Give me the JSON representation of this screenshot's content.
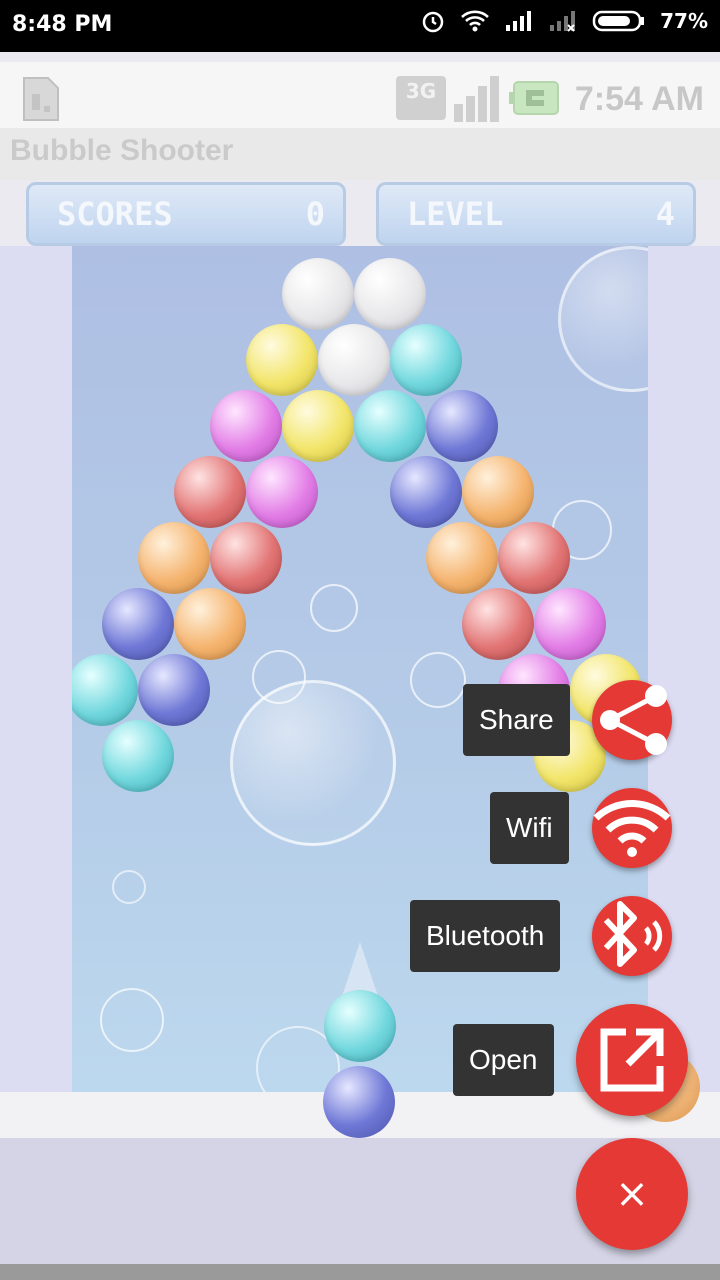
{
  "status_bar": {
    "time": "8:48 PM",
    "battery": "77%"
  },
  "emulator_bar": {
    "clock": "7:54 AM",
    "network": "3G"
  },
  "app": {
    "title": "Bubble Shooter"
  },
  "hud": {
    "scores_label": "SCORES",
    "scores_value": "0",
    "level_label": "LEVEL",
    "level_value": "4"
  },
  "fab_menu": {
    "items": [
      {
        "label": "Share"
      },
      {
        "label": "Wifi"
      },
      {
        "label": "Bluetooth"
      },
      {
        "label": "Open"
      }
    ],
    "close_symbol": "×"
  },
  "colors": {
    "accent": "#e53935",
    "chip": "#333333"
  }
}
